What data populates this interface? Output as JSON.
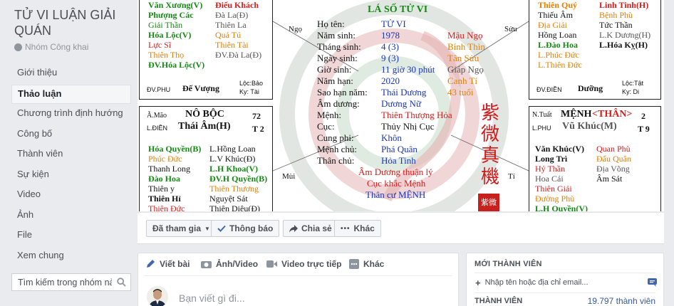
{
  "sidebar": {
    "group_title": "TỬ VI LUẬN GIẢI QUÁN",
    "privacy": "Nhóm Công khai",
    "nav": [
      "Giới thiệu",
      "Thảo luận",
      "Chương trình định hướng",
      "Công bố",
      "Thành viên",
      "Sự kiện",
      "Video",
      "Ảnh",
      "File",
      "Xem chung"
    ],
    "search_placeholder": "Tìm kiếm trong nhóm này"
  },
  "chart": {
    "tl": {
      "l1": [
        "Văn Xương(V)",
        "Điếu Khách"
      ],
      "l2": [
        "Phượng Các",
        "Đà La(Đ)"
      ],
      "l3": [
        "Giải Thần",
        "Thiên La"
      ],
      "l4": [
        "Hóa Lộc(V)",
        "Quả Tú"
      ],
      "l5": [
        "Lực Sĩ",
        "Thiên Tài"
      ],
      "l6": [
        "Thiên Thọ",
        "ĐV.Đà La(Đ)"
      ],
      "l7": "ĐV.Hóa Lộc(V)",
      "foot_left": "ĐV.PHU",
      "foot_center": "Đế Vượng",
      "foot_right1": "Lộc:Bảo",
      "foot_right2": "Ky: Tài"
    },
    "tr": {
      "l1": [
        "Thiên Quý",
        "Linh Tinh(H)"
      ],
      "l2": [
        "Thiếu Âm",
        "Bệnh Phù"
      ],
      "l3": [
        "Địa Giải",
        "Tức Thần"
      ],
      "l4": [
        "Hồng Loan",
        "L.K Dương(H)"
      ],
      "l5": [
        "L.Đào Hoa",
        "L.Hóa Kỵ(H)"
      ],
      "l6": "L.Phúc Đức",
      "l7": "L.Thiên Đức",
      "foot_left": "ĐV.ĐIỀN",
      "foot_center": "Dưỡng",
      "foot_right1": "Lộc:Tật",
      "foot_right2": "Ky: Di"
    },
    "ml": {
      "branch": "Ã.Mão",
      "name": "NÔ BỘC",
      "num": "72",
      "sub": "L.ĐIỀN",
      "star": "Thái Âm(H)",
      "t": "T 2",
      "rows": [
        [
          "Hóa Quyền(B)",
          "L.Hồng Loan"
        ],
        [
          "Phúc Đức",
          "L.V Khúc(Đ)"
        ],
        [
          "Thanh Long",
          "L.H Khoa(V)"
        ],
        [
          "Đào Hoa",
          "ĐV.H Quyền(B)"
        ],
        [
          "Thiên y",
          "Thiên Thương"
        ],
        [
          "Thiên Hỉ",
          "Nguyệt Sát"
        ],
        [
          "Thiên Đức",
          "Thiên Diêu(Đ)"
        ]
      ]
    },
    "mr": {
      "branch": "N.Tuất",
      "name": "MỆNH",
      "than": "<THÂN>",
      "num": "2",
      "sub": "L.PHU",
      "star": "Vũ Khúc(M)",
      "t": "T 9",
      "rows": [
        [
          "Văn Khúc(V)",
          "Quan Phù"
        ],
        [
          "Long Trì",
          "Đẩu Quân"
        ],
        [
          "Hỷ Thần",
          "Địa Võng"
        ],
        [
          "Hoa Cái",
          "Âm Sát"
        ],
        [
          "Thiên Giải",
          ""
        ],
        [
          "Đường Phù",
          ""
        ],
        [
          "L.H Quyền(V)",
          ""
        ]
      ]
    },
    "center": {
      "title": "LÁ SỐ TỬ VI",
      "labels": [
        "Họ tên:",
        "Năm sinh:",
        "Tháng sinh:",
        "Ngày sinh:",
        "Giờ sinh:",
        "Năm hạn:",
        "Sao hạn năm:",
        "Âm dương:",
        "Mệnh:",
        "Cục:",
        "Cung phi:",
        "Mệnh chủ:",
        "Thân chủ:"
      ],
      "values": [
        "TỬ VI",
        "1978",
        "4 (3)",
        "9 (3)",
        "11 giờ 30 phút",
        "2020",
        "Thái Dương",
        "Dương Nữ",
        "Thiên Thượng Hỏa",
        "Thủy Nhị Cục",
        "Khôn",
        "Phá Quân",
        "Hỏa Tinh"
      ],
      "extras": [
        "Mậu Ngọ",
        "Bính Thìn",
        "Tân Sửu",
        "Giáp Ngọ",
        "Canh Tí",
        "43 tuổi"
      ],
      "footer": [
        "Âm Dương thuận lý",
        "Cục khắc Mệnh",
        "Thân cư MỆNH"
      ],
      "corners": {
        "ngo": "Ngọ",
        "suu": "Sửu",
        "mui": "Mùi",
        "ti": "Tí"
      },
      "vertical": [
        "紫",
        "微",
        "真",
        "機"
      ],
      "seal": "紫微"
    }
  },
  "actions": {
    "joined": "Đã tham gia",
    "notify": "Thông báo",
    "share": "Chia sẻ",
    "more": "Khác"
  },
  "composer": {
    "tabs": [
      "Viết bài",
      "Ảnh/Video",
      "Video trực tiếp",
      "Khác"
    ],
    "placeholder": "Bạn viết gì đi..."
  },
  "members": {
    "header": "MỚI THÀNH VIÊN",
    "add_placeholder": "Nhập tên hoặc địa chỉ email...",
    "label": "THÀNH VIÊN",
    "count": "19.797 thành viên"
  },
  "colors": {
    "accent": "#4267b2",
    "link": "#365899",
    "chart_red": "#d81b1b",
    "chart_blue": "#1a35b5",
    "chart_green": "#128a12",
    "chart_orange": "#e67e00"
  },
  "icons": [
    "globe-icon",
    "search-icon",
    "caret-down-icon",
    "check-icon",
    "share-icon",
    "more-dots-icon",
    "pencil-icon",
    "camera-icon",
    "video-icon",
    "grid-icon",
    "plus-icon",
    "message-icon"
  ]
}
